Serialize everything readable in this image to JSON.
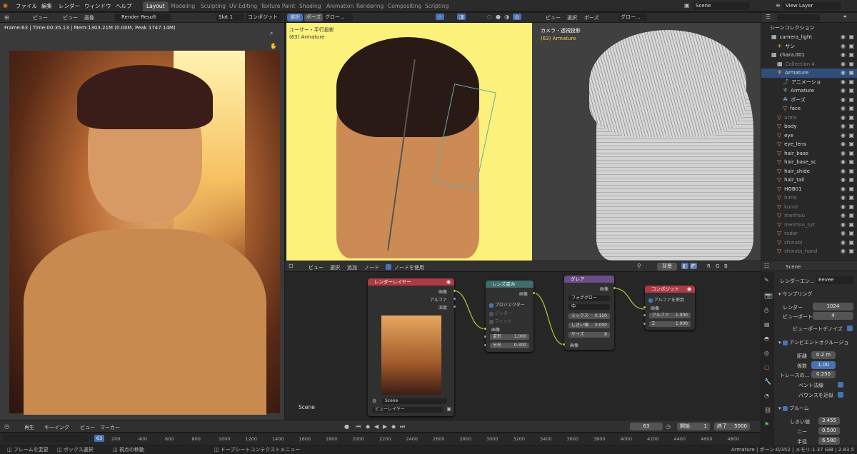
{
  "top_menu": [
    "ファイル",
    "編集",
    "レンダー",
    "ウィンドウ",
    "ヘルプ"
  ],
  "workspace_tabs": [
    "Layout",
    "Modeling",
    "Sculpting",
    "UV Editing",
    "Texture Paint",
    "Shading",
    "Animation",
    "Rendering",
    "Compositing",
    "Scripting"
  ],
  "active_tab": "Layout",
  "scene_name": "Scene",
  "view_layer": "View Layer",
  "image_editor": {
    "menus": [
      "ビュー",
      "ビュー",
      "画像"
    ],
    "image_name": "Render Result",
    "slot": "Slot 1",
    "pass": "コンポジット",
    "stats": "Frame:63 | Time:00:35.13 | Mem:1303.21M (0.00M, Peak 1747.14M)"
  },
  "viewport_left": {
    "mode_buttons": [
      "選択",
      "ポーズ"
    ],
    "orientation": "グロー...",
    "overlay_label": "ユーザー・平行投影",
    "overlay_sub": "(63) Armature"
  },
  "viewport_right": {
    "menus": [
      "ビュー",
      "選択",
      "ポーズ"
    ],
    "orientation": "グロー...",
    "title": "カメラ・透視投影",
    "subtitle": "(63) Armature"
  },
  "outliner": {
    "title": "シーンコレクション",
    "rows": [
      {
        "label": "camera_light",
        "indent": 1,
        "icon": "collection-icon",
        "sel": false,
        "dim": false
      },
      {
        "label": "サン",
        "indent": 2,
        "icon": "sun-icon",
        "sel": false,
        "dim": false
      },
      {
        "label": "chara.001",
        "indent": 1,
        "icon": "collection-icon",
        "sel": false,
        "dim": false
      },
      {
        "label": "Collection 4",
        "indent": 2,
        "icon": "collection-icon",
        "sel": false,
        "dim": true
      },
      {
        "label": "Armature",
        "indent": 2,
        "icon": "armature-icon",
        "sel": true,
        "dim": false
      },
      {
        "label": "アニメーショ",
        "indent": 3,
        "icon": "action-icon",
        "sel": false,
        "dim": false
      },
      {
        "label": "Armature",
        "indent": 3,
        "icon": "armature-data-icon",
        "sel": false,
        "dim": false
      },
      {
        "label": "ポーズ",
        "indent": 3,
        "icon": "pose-icon",
        "sel": false,
        "dim": false
      },
      {
        "label": "face",
        "indent": 3,
        "icon": "mesh-icon",
        "sel": false,
        "dim": false
      },
      {
        "label": "arms",
        "indent": 2,
        "icon": "mesh-icon",
        "sel": false,
        "dim": true
      },
      {
        "label": "body",
        "indent": 2,
        "icon": "mesh-icon",
        "sel": false,
        "dim": false
      },
      {
        "label": "eye",
        "indent": 2,
        "icon": "mesh-icon",
        "sel": false,
        "dim": false
      },
      {
        "label": "eye_lens",
        "indent": 2,
        "icon": "mesh-icon",
        "sel": false,
        "dim": false
      },
      {
        "label": "hair_base",
        "indent": 2,
        "icon": "mesh-icon",
        "sel": false,
        "dim": false
      },
      {
        "label": "hair_base_sc",
        "indent": 2,
        "icon": "mesh-icon",
        "sel": false,
        "dim": false
      },
      {
        "label": "hair_shide",
        "indent": 2,
        "icon": "mesh-icon",
        "sel": false,
        "dim": false
      },
      {
        "label": "hair_tail",
        "indent": 2,
        "icon": "mesh-icon",
        "sel": false,
        "dim": false
      },
      {
        "label": "HGB01",
        "indent": 2,
        "icon": "mesh-icon",
        "sel": false,
        "dim": false
      },
      {
        "label": "himo",
        "indent": 2,
        "icon": "mesh-icon",
        "sel": false,
        "dim": true
      },
      {
        "label": "kunai",
        "indent": 2,
        "icon": "mesh-icon",
        "sel": false,
        "dim": true
      },
      {
        "label": "menhou",
        "indent": 2,
        "icon": "mesh-icon",
        "sel": false,
        "dim": true
      },
      {
        "label": "menhou_syt",
        "indent": 2,
        "icon": "mesh-icon",
        "sel": false,
        "dim": true
      },
      {
        "label": "radar",
        "indent": 2,
        "icon": "mesh-icon",
        "sel": false,
        "dim": true
      },
      {
        "label": "shinobi",
        "indent": 2,
        "icon": "mesh-icon",
        "sel": false,
        "dim": true
      },
      {
        "label": "shinobi_hand",
        "indent": 2,
        "icon": "mesh-icon",
        "sel": false,
        "dim": true
      }
    ]
  },
  "node_editor": {
    "menus": [
      "ビュー",
      "選択",
      "追加",
      "ノード"
    ],
    "use_nodes": "ノードを使用",
    "backdrop": "背景",
    "channels": [
      "R",
      "G",
      "B"
    ],
    "scene_label": "Scene",
    "render_layer": {
      "title": "レンダーレイヤー",
      "outputs": [
        "画像",
        "アルファ",
        "深度"
      ],
      "scene": "Scene",
      "view_layer": "ビューレイヤー"
    },
    "lens_distortion": {
      "title": "レンズ歪み",
      "output": "画像",
      "projector": "プロジェクター",
      "jitter": "ジッター",
      "fit": "フィット",
      "input": "画像",
      "distort_label": "変形",
      "distort": "1.000",
      "dispersion_label": "分光",
      "dispersion": "0.300"
    },
    "glare": {
      "title": "グレア",
      "output": "画像",
      "type": "フォググロー",
      "quality": "中",
      "mix_label": "ミックス",
      "mix": "0.150",
      "threshold_label": "しきい値",
      "threshold": "0.000",
      "size_label": "サイズ",
      "size": "8",
      "input": "画像"
    },
    "composite": {
      "title": "コンポジット",
      "use_alpha": "アルファを使用",
      "input": "画像",
      "alpha_label": "アルファ",
      "alpha": "1.000",
      "z_label": "Z",
      "z": "1.000"
    }
  },
  "properties": {
    "scene": "Scene",
    "engine_label": "レンダーエン...",
    "engine": "Eevee",
    "sampling": "サンプリング",
    "render_label": "レンダー",
    "render": "1024",
    "viewport_label": "ビューポート",
    "viewport": "4",
    "denoise": "ビューポートデノイズ",
    "ao": "アンビエントオクルージョ",
    "distance_label": "距離",
    "distance": "0.2 m",
    "factor_label": "係数",
    "factor": "1.00",
    "trace_label": "トレースの...",
    "trace": "0.250",
    "bent_normals": "ベント法線",
    "bounce": "バウンスを近似",
    "bloom": "ブルーム",
    "threshold_label": "しきい値",
    "threshold": "3.455",
    "knee_label": "ニー",
    "knee": "0.500",
    "radius_label": "半径",
    "radius": "6.580"
  },
  "timeline": {
    "menus": [
      "再生",
      "キーイング",
      "ビュー",
      "マーカー"
    ],
    "current_frame": "63",
    "start_label": "開始",
    "start": "1",
    "end_label": "終了",
    "end": "5000",
    "ticks": [
      "200",
      "400",
      "600",
      "800",
      "1000",
      "1200",
      "1400",
      "1600",
      "1800",
      "2000",
      "2200",
      "2400",
      "2600",
      "2800",
      "3000",
      "3200",
      "3400",
      "3600",
      "3800",
      "4000",
      "4200",
      "4400",
      "4600",
      "4800"
    ]
  },
  "status_bar": {
    "left": [
      "フレームを変更",
      "ボックス選択",
      "視点の移動",
      "ドープシートコンテクストメニュー"
    ],
    "right": "Armature | ボーン:0/352 | メモリ:1.37 GiB | 2.83.5"
  }
}
